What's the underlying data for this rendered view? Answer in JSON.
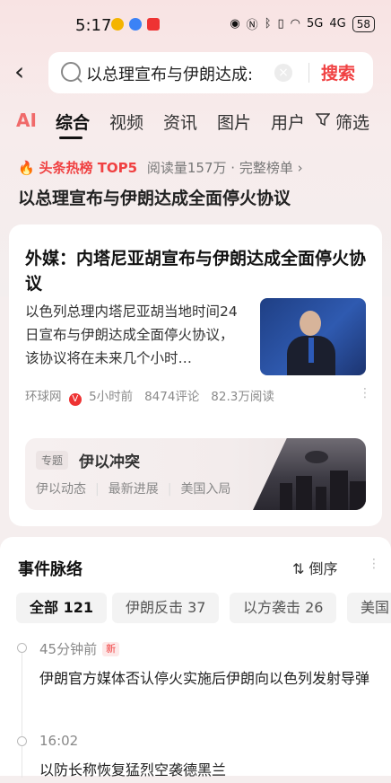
{
  "status_bar": {
    "time": "5:17",
    "network": "5G",
    "network2": "4G",
    "battery": "58"
  },
  "search": {
    "query": "以总理宣布与伊朗达成:",
    "button_label": "搜索"
  },
  "tabs": [
    {
      "label": "AI"
    },
    {
      "label": "综合"
    },
    {
      "label": "视频"
    },
    {
      "label": "资讯"
    },
    {
      "label": "图片"
    },
    {
      "label": "用户"
    },
    {
      "label": "筛选"
    }
  ],
  "hot": {
    "label": "头条热榜 TOP5",
    "meta": "阅读量157万 · 完整榜单 ›",
    "title": "以总理宣布与伊朗达成全面停火协议"
  },
  "article": {
    "title": "外媒：内塔尼亚胡宣布与伊朗达成全面停火协议",
    "body": "以色列总理内塔尼亚胡当地时间24日宣布与伊朗达成全面停火协议，该协议将在未来几个小时…",
    "source": "环球网",
    "verified": "V",
    "time": "5小时前",
    "comments": "8474评论",
    "reads": "82.3万阅读"
  },
  "topic": {
    "tag": "专题",
    "title": "伊以冲突",
    "links": [
      "伊以动态",
      "最新进展",
      "美国入局"
    ]
  },
  "timeline": {
    "title": "事件脉络",
    "sort_label": "倒序",
    "chips": [
      "全部 121",
      "伊朗反击 37",
      "以方袭击 26",
      "美国"
    ],
    "items": [
      {
        "time": "45分钟前",
        "badge": "新",
        "text": "伊朗官方媒体否认停火实施后伊朗向以色列发射导弹"
      },
      {
        "time": "16:02",
        "text": "以防长称恢复猛烈空袭德黑兰"
      }
    ]
  }
}
